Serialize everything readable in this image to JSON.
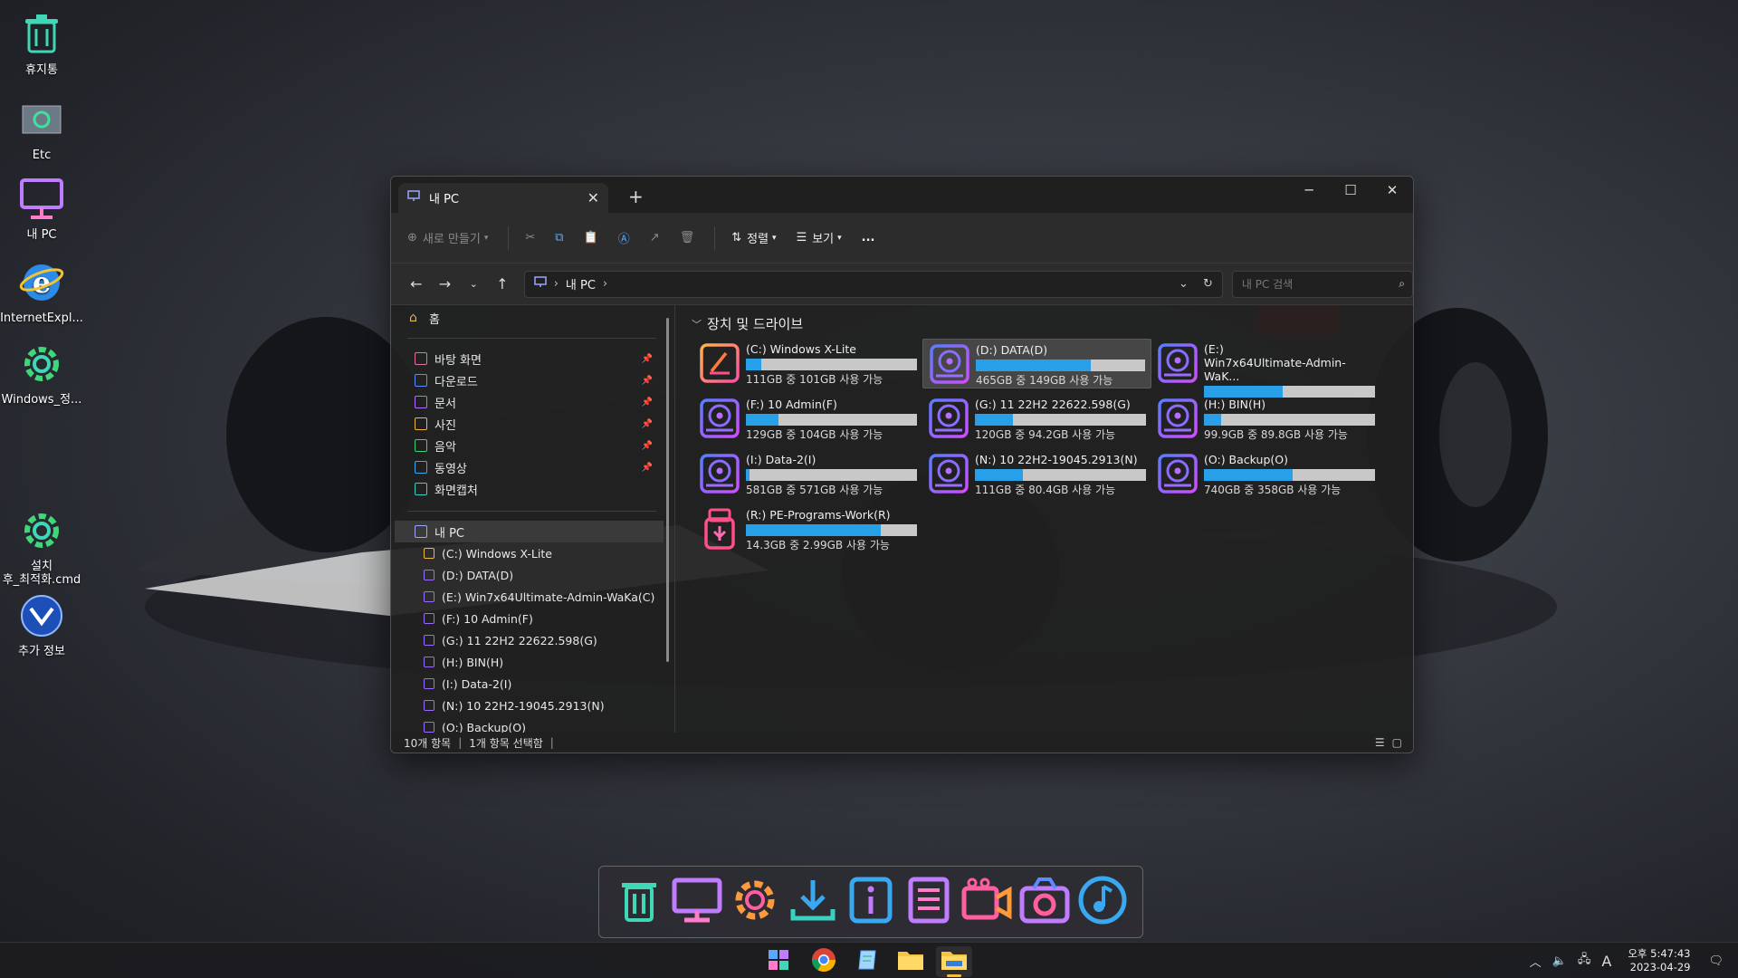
{
  "desktop": {
    "icons": [
      {
        "label": "휴지통",
        "icon": "recycle-bin-icon"
      },
      {
        "label": "Etc",
        "icon": "etc-icon"
      },
      {
        "label": "내 PC",
        "icon": "monitor-icon"
      },
      {
        "label": "InternetExpl...",
        "icon": "internet-explorer-icon"
      },
      {
        "label": "Windows_정...",
        "icon": "gear-icon"
      },
      {
        "label": "설치\n후_최적화.cmd",
        "icon": "gear-icon"
      },
      {
        "label": "추가 정보",
        "icon": "info-globe-icon"
      }
    ]
  },
  "window": {
    "tab_title": "내 PC",
    "toolbar": {
      "new": "새로 만들기",
      "sort": "정렬",
      "view": "보기",
      "more": "..."
    },
    "address": {
      "path": "내 PC",
      "search_placeholder": "내 PC 검색"
    },
    "nav": {
      "home": "홈",
      "quick": [
        {
          "label": "바탕 화면",
          "color": "#e36fa0",
          "pinned": true
        },
        {
          "label": "다운로드",
          "color": "#5a8cff",
          "pinned": true
        },
        {
          "label": "문서",
          "color": "#b46cff",
          "pinned": true
        },
        {
          "label": "사진",
          "color": "#f0b63c",
          "pinned": true
        },
        {
          "label": "음악",
          "color": "#3ad17a",
          "pinned": true
        },
        {
          "label": "동영상",
          "color": "#3aa8f0",
          "pinned": true
        },
        {
          "label": "화면캡처",
          "color": "#3ad1c0",
          "pinned": false
        }
      ],
      "this_pc": "내 PC",
      "drives": [
        "(C:) Windows X-Lite",
        "(D:) DATA(D)",
        "(E:) Win7x64Ultimate-Admin-WaKa(C)",
        "(F:) 10 Admin(F)",
        "(G:) 11 22H2 22622.598(G)",
        "(H:) BIN(H)",
        "(I:) Data-2(I)",
        "(N:) 10 22H2-19045.2913(N)",
        "(O:) Backup(O)"
      ]
    },
    "section_title": "장치 및 드라이브",
    "drives": [
      {
        "name": "(C:) Windows X-Lite",
        "free": "111GB 중 101GB 사용 가능",
        "used_fraction": 0.09,
        "kind": "system",
        "selected": false
      },
      {
        "name": "(D:) DATA(D)",
        "free": "465GB 중 149GB 사용 가능",
        "used_fraction": 0.68,
        "kind": "disk",
        "selected": true
      },
      {
        "name": "(E:)\nWin7x64Ultimate-Admin-WaK...",
        "free": "",
        "used_fraction": 0.46,
        "kind": "disk",
        "selected": false
      },
      {
        "name": "(F:) 10 Admin(F)",
        "free": "129GB 중 104GB 사용 가능",
        "used_fraction": 0.19,
        "kind": "disk",
        "selected": false
      },
      {
        "name": "(G:) 11 22H2 22622.598(G)",
        "free": "120GB 중 94.2GB 사용 가능",
        "used_fraction": 0.22,
        "kind": "disk",
        "selected": false
      },
      {
        "name": "(H:) BIN(H)",
        "free": "99.9GB 중 89.8GB 사용 가능",
        "used_fraction": 0.1,
        "kind": "disk",
        "selected": false
      },
      {
        "name": "(I:) Data-2(I)",
        "free": "581GB 중 571GB 사용 가능",
        "used_fraction": 0.02,
        "kind": "disk",
        "selected": false
      },
      {
        "name": "(N:) 10 22H2-19045.2913(N)",
        "free": "111GB 중 80.4GB 사용 가능",
        "used_fraction": 0.28,
        "kind": "disk",
        "selected": false
      },
      {
        "name": "(O:) Backup(O)",
        "free": "740GB 중 358GB 사용 가능",
        "used_fraction": 0.52,
        "kind": "disk",
        "selected": false
      },
      {
        "name": "(R:) PE-Programs-Work(R)",
        "free": "14.3GB 중 2.99GB 사용 가능",
        "used_fraction": 0.79,
        "kind": "usb",
        "selected": false
      }
    ],
    "status": {
      "items": "10개 항목",
      "selected": "1개 항목 선택함"
    }
  },
  "dock": [
    "recycle-bin-icon",
    "monitor-icon",
    "gear-icon",
    "download-icon",
    "info-icon",
    "document-icon",
    "video-icon",
    "camera-icon",
    "music-icon"
  ],
  "taskbar": {
    "apps": [
      "start-icon",
      "chrome-icon",
      "notepad-icon",
      "folder-icon",
      "explorer-icon"
    ],
    "time": "오후 5:47:43",
    "date": "2023-04-29",
    "ime": "A"
  },
  "colors": {
    "accent": "#27a0e8",
    "bar_bg": "#c8c8c8"
  }
}
